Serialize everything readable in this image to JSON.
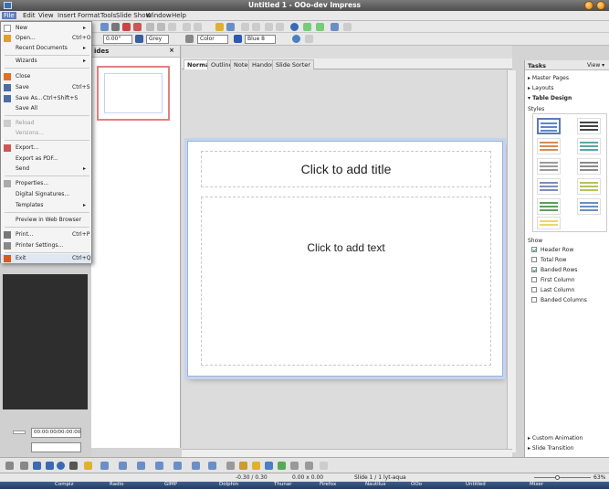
{
  "window": {
    "title": "Untitled 1 - OOo-dev Impress"
  },
  "menubar": {
    "items": [
      "File",
      "Edit",
      "View",
      "Insert",
      "Format",
      "Tools",
      "Slide Show",
      "Window",
      "Help"
    ]
  },
  "toolbar2": {
    "angle": "0.00\"",
    "line_color": "Grey",
    "fill_type": "Color",
    "fill_color": "Blue 8"
  },
  "file_menu": {
    "items": [
      {
        "label": "New",
        "shortcut": "",
        "arrow": "▸"
      },
      {
        "label": "Open...",
        "shortcut": "Ctrl+O",
        "arrow": ""
      },
      {
        "label": "Recent Documents",
        "shortcut": "",
        "arrow": "▸"
      },
      {
        "label": "Wizards",
        "shortcut": "",
        "arrow": "▸"
      },
      {
        "label": "Close",
        "shortcut": "",
        "arrow": ""
      },
      {
        "label": "Save",
        "shortcut": "Ctrl+S",
        "arrow": ""
      },
      {
        "label": "Save As...",
        "shortcut": "Ctrl+Shift+S",
        "arrow": ""
      },
      {
        "label": "Save All",
        "shortcut": "",
        "arrow": ""
      },
      {
        "label": "Reload",
        "shortcut": "",
        "arrow": ""
      },
      {
        "label": "Versions...",
        "shortcut": "",
        "arrow": ""
      },
      {
        "label": "Export...",
        "shortcut": "",
        "arrow": ""
      },
      {
        "label": "Export as PDF...",
        "shortcut": "",
        "arrow": ""
      },
      {
        "label": "Send",
        "shortcut": "",
        "arrow": "▸"
      },
      {
        "label": "Properties...",
        "shortcut": "",
        "arrow": ""
      },
      {
        "label": "Digital Signatures...",
        "shortcut": "",
        "arrow": ""
      },
      {
        "label": "Templates",
        "shortcut": "",
        "arrow": "▸"
      },
      {
        "label": "Preview in Web Browser",
        "shortcut": "",
        "arrow": ""
      },
      {
        "label": "Print...",
        "shortcut": "Ctrl+P",
        "arrow": ""
      },
      {
        "label": "Printer Settings...",
        "shortcut": "",
        "arrow": ""
      },
      {
        "label": "Exit",
        "shortcut": "Ctrl+Q",
        "arrow": ""
      }
    ]
  },
  "slides_pane": {
    "header": "ides",
    "close": "×"
  },
  "view_tabs": [
    "Normal",
    "Outline",
    "Notes",
    "Handout",
    "Slide Sorter"
  ],
  "slide": {
    "title_placeholder": "Click to add title",
    "content_placeholder": "Click to add text"
  },
  "tasks_pane": {
    "title": "Tasks",
    "view_label": "View ▾",
    "sections": [
      "Master Pages",
      "Layouts",
      "Table Design"
    ],
    "styles_label": "Styles",
    "show_label": "Show",
    "options": [
      {
        "label": "Header Row",
        "checked": true
      },
      {
        "label": "Total Row",
        "checked": false
      },
      {
        "label": "Banded Rows",
        "checked": true
      },
      {
        "label": "First Column",
        "checked": false
      },
      {
        "label": "Last Column",
        "checked": false
      },
      {
        "label": "Banded Columns",
        "checked": false
      }
    ],
    "bottom_sections": [
      "Custom Animation",
      "Slide Transition"
    ],
    "style_colors": [
      "#5b88c9",
      "#444444",
      "#d98b4f",
      "#5aa6a6",
      "#9a9a9a",
      "#8a8a8a",
      "#7b8fb8",
      "#b7c35a",
      "#5ba05b",
      "#6a8ec4",
      "#59b0a0",
      "#9a9a9a",
      "#e8d86a"
    ]
  },
  "time_field": "00:00:00/00:00:00",
  "statusbar": {
    "position": "-0.30 / 0.30",
    "size": "0.00 x 0.00",
    "slide": "Slide 1 / 1",
    "layout": "lyt-aqua",
    "zoom": "63%"
  },
  "taskbar": {
    "items": [
      "Compiz",
      "Radio",
      "GIMP",
      "Dolphin",
      "Thunar",
      "Firefox",
      "Nautilus",
      "OOo",
      "Untitled",
      "Mixer"
    ]
  }
}
